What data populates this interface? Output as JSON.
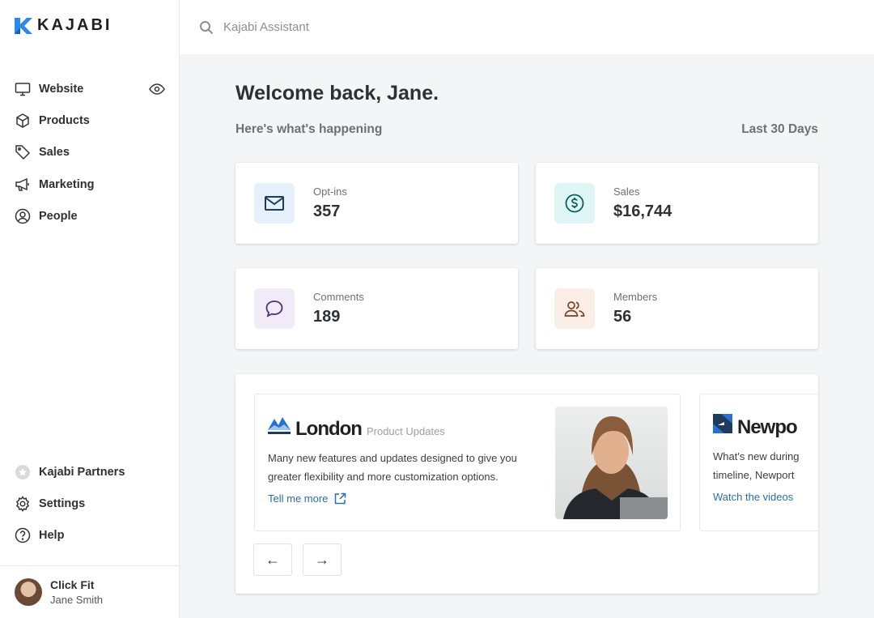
{
  "brand": "KAJABI",
  "nav": [
    {
      "label": "Website"
    },
    {
      "label": "Products"
    },
    {
      "label": "Sales"
    },
    {
      "label": "Marketing"
    },
    {
      "label": "People"
    }
  ],
  "bottom_nav": [
    {
      "label": "Kajabi Partners"
    },
    {
      "label": "Settings"
    },
    {
      "label": "Help"
    }
  ],
  "user": {
    "site": "Click Fit",
    "name": "Jane Smith"
  },
  "search": {
    "placeholder": "Kajabi Assistant"
  },
  "main": {
    "title": "Welcome back, Jane.",
    "subtitle": "Here's what's happening",
    "range": "Last 30 Days"
  },
  "stats": [
    {
      "label": "Opt-ins",
      "value": "357",
      "bg": "#e6f0fb",
      "fg": "#1e3a5f"
    },
    {
      "label": "Sales",
      "value": "$16,744",
      "bg": "#e0f5f5",
      "fg": "#0b5e5e"
    },
    {
      "label": "Comments",
      "value": "189",
      "bg": "#f1ebf8",
      "fg": "#4b3270"
    },
    {
      "label": "Members",
      "value": "56",
      "bg": "#fbeee6",
      "fg": "#7a3f25"
    }
  ],
  "updates": [
    {
      "name": "London",
      "tag": "Product Updates",
      "desc": "Many new features and updates designed to give you greater flexibility and more customization options.",
      "link": "Tell me more"
    },
    {
      "name": "Newpo",
      "desc": "What's new during timeline, Newport",
      "link": "Watch the videos"
    }
  ]
}
